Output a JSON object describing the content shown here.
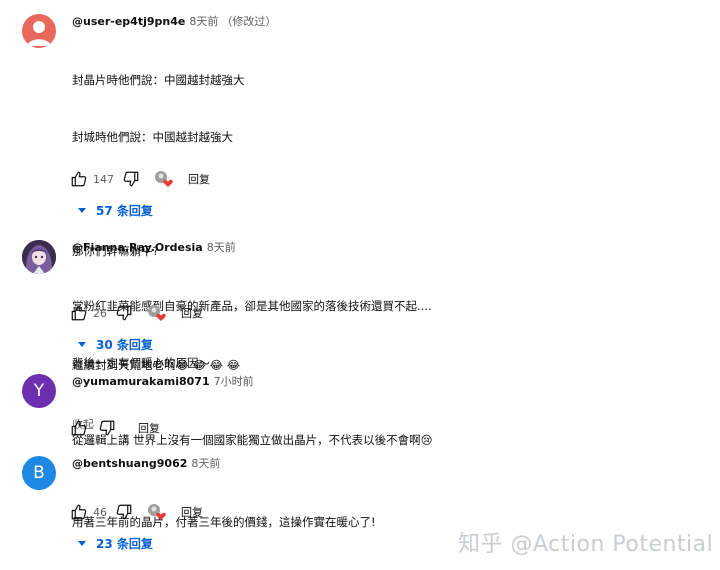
{
  "comments": [
    {
      "author": "@user-ep4tj9pn4e",
      "time": "8天前",
      "edited": "（修改过）",
      "lines": [
        "封晶片時他們說：中國越封越強大",
        "封城時他們說：中國越封越強大",
        "",
        "那你們幹嘛躺平?",
        "",
        "繼續封到天荒地老啊😂 😂 😂 😂"
      ],
      "collapse": "收起",
      "likes": "147",
      "reply_label": "回复",
      "replies": "57 条回复",
      "avatar_color": "#e8685b"
    },
    {
      "author": "@Fianna.Ray.Ordesia",
      "time": "8天前",
      "lines": [
        "當粉紅韭菜能感到自豪的新產品，卻是其他國家的落後技術還買不起....",
        "背後一定有個暖心的原因～"
      ],
      "likes": "26",
      "reply_label": "回复",
      "replies": "30 条回复"
    },
    {
      "author": "@yumamurakami8071",
      "time": "7小时前",
      "avatar_letter": "Y",
      "avatar_color": "#6c2fb0",
      "lines": [
        "從邏輯上講 世界上沒有一個國家能獨立做出晶片，不代表以後不會啊😢"
      ],
      "reply_label": "回复"
    },
    {
      "author": "@bentshuang9062",
      "time": "8天前",
      "avatar_letter": "B",
      "avatar_color": "#1e88e5",
      "lines": [
        "用著三年前的晶片，付著三年後的價錢，這操作實在暖心了!"
      ],
      "likes": "46",
      "reply_label": "回复",
      "replies": "23 条回复"
    }
  ],
  "watermark": "知乎 @Action Potential",
  "colors": {
    "link": "#065fd4",
    "muted": "#606060",
    "heart": "#e53935"
  }
}
